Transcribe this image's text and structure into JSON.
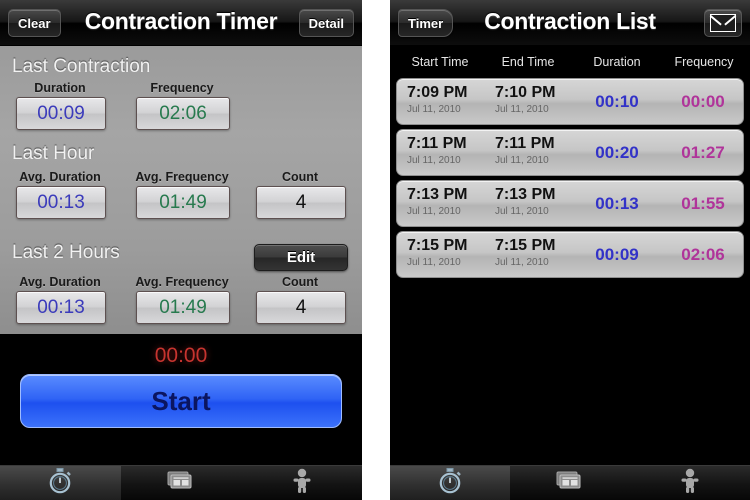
{
  "timer_screen": {
    "nav": {
      "left_button": "Clear",
      "title": "Contraction Timer",
      "right_button": "Detail"
    },
    "sections": [
      {
        "heading": "Last Contraction",
        "fields": [
          {
            "label": "Duration",
            "value": "00:09",
            "kind": "duration"
          },
          {
            "label": "Frequency",
            "value": "02:06",
            "kind": "frequency"
          }
        ]
      },
      {
        "heading": "Last Hour",
        "fields": [
          {
            "label": "Avg. Duration",
            "value": "00:13",
            "kind": "duration"
          },
          {
            "label": "Avg. Frequency",
            "value": "01:49",
            "kind": "frequency"
          },
          {
            "label": "Count",
            "value": "4",
            "kind": "count"
          }
        ]
      },
      {
        "heading": "Last 2 Hours",
        "edit_button": "Edit",
        "fields": [
          {
            "label": "Avg. Duration",
            "value": "00:13",
            "kind": "duration"
          },
          {
            "label": "Avg. Frequency",
            "value": "01:49",
            "kind": "frequency"
          },
          {
            "label": "Count",
            "value": "4",
            "kind": "count"
          }
        ]
      }
    ],
    "running_timer": "00:00",
    "start_button": "Start"
  },
  "list_screen": {
    "nav": {
      "back_button": "Timer",
      "title": "Contraction List",
      "right_icon": "envelope-icon"
    },
    "columns": [
      "Start Time",
      "End Time",
      "Duration",
      "Frequency"
    ],
    "rows": [
      {
        "start_time": "7:09 PM",
        "start_date": "Jul 11, 2010",
        "end_time": "7:10 PM",
        "end_date": "Jul 11, 2010",
        "duration": "00:10",
        "frequency": "00:00"
      },
      {
        "start_time": "7:11 PM",
        "start_date": "Jul 11, 2010",
        "end_time": "7:11 PM",
        "end_date": "Jul 11, 2010",
        "duration": "00:20",
        "frequency": "01:27"
      },
      {
        "start_time": "7:13 PM",
        "start_date": "Jul 11, 2010",
        "end_time": "7:13 PM",
        "end_date": "Jul 11, 2010",
        "duration": "00:13",
        "frequency": "01:55"
      },
      {
        "start_time": "7:15 PM",
        "start_date": "Jul 11, 2010",
        "end_time": "7:15 PM",
        "end_date": "Jul 11, 2010",
        "duration": "00:09",
        "frequency": "02:06"
      }
    ]
  },
  "tabbar": {
    "tabs": [
      {
        "icon": "stopwatch-icon",
        "selected": true
      },
      {
        "icon": "list-cards-icon",
        "selected": false
      },
      {
        "icon": "baby-icon",
        "selected": false
      }
    ]
  },
  "colors": {
    "duration": "#3b3bbb",
    "frequency": "#277a4e",
    "list_duration": "#3232c8",
    "list_frequency": "#b0349a",
    "timer_red": "#c6342f",
    "start_blue": "#2f63f5"
  }
}
